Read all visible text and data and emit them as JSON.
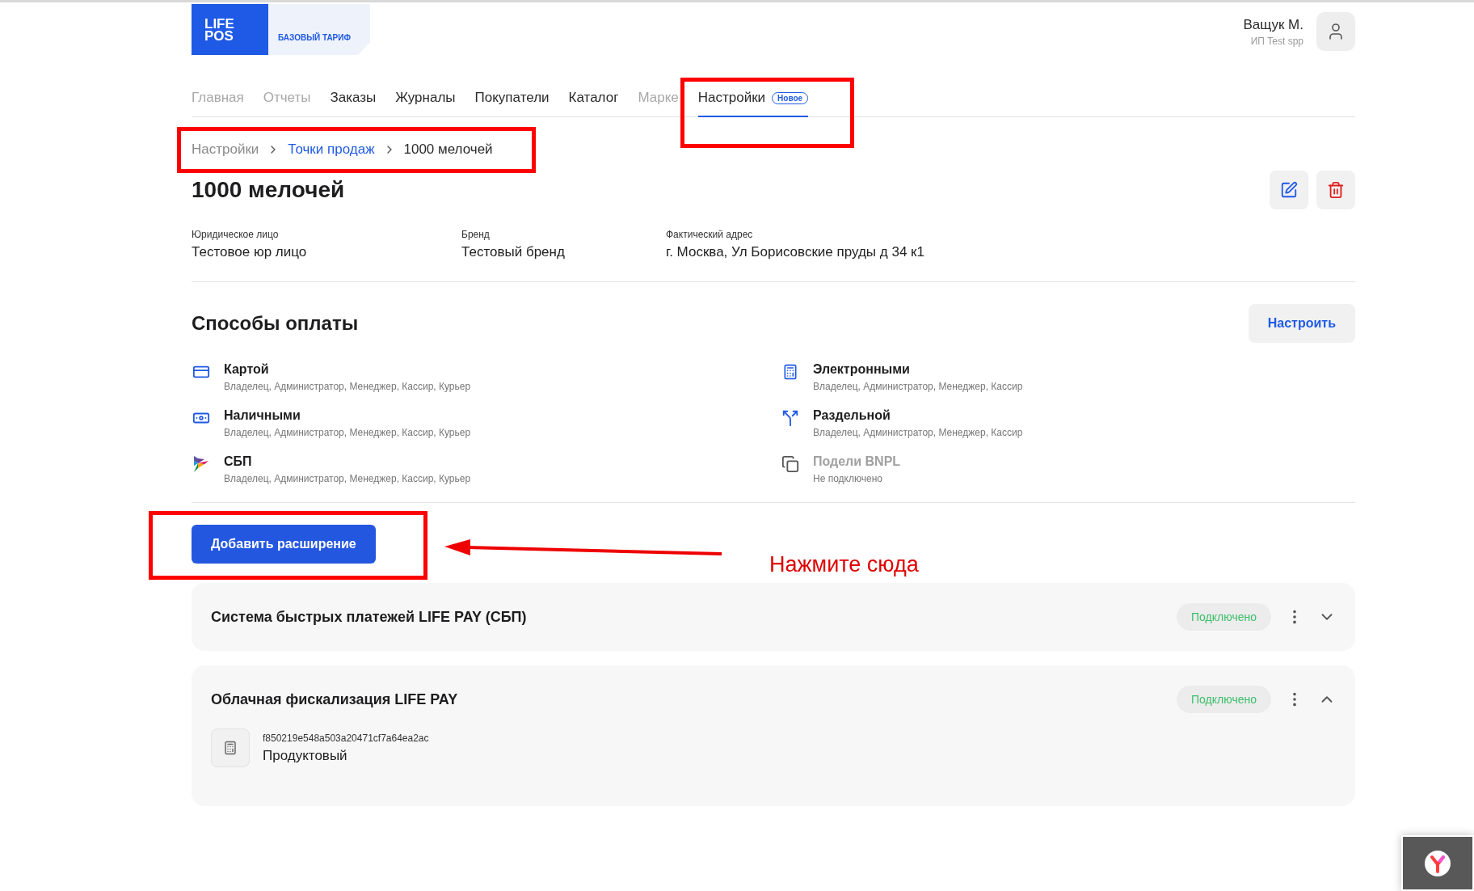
{
  "header": {
    "logo": [
      "LIFE",
      "POS"
    ],
    "plan": "БАЗОВЫЙ ТАРИФ",
    "user": {
      "name": "Ващук М.",
      "org": "ИП Test spp"
    }
  },
  "nav": [
    {
      "label": "Главная",
      "selected": false,
      "muted": true
    },
    {
      "label": "Отчеты",
      "selected": false,
      "muted": true
    },
    {
      "label": "Заказы",
      "selected": false,
      "muted": false
    },
    {
      "label": "Журналы",
      "selected": false,
      "muted": false
    },
    {
      "label": "Покупатели",
      "selected": false,
      "muted": false
    },
    {
      "label": "Каталог",
      "selected": false,
      "muted": false
    },
    {
      "label": "Марке",
      "selected": false,
      "muted": true
    },
    {
      "label": "Настройки",
      "selected": true,
      "muted": false,
      "badge": "Новое"
    }
  ],
  "breadcrumb": [
    {
      "label": "Настройки",
      "kind": "root"
    },
    {
      "label": "Точки продаж",
      "kind": "link"
    },
    {
      "label": "1000 мелочей",
      "kind": "current"
    }
  ],
  "title": "1000 мелочей",
  "info": [
    {
      "label": "Юридическое лицо",
      "value": "Тестовое юр лицо"
    },
    {
      "label": "Бренд",
      "value": "Тестовый бренд"
    },
    {
      "label": "Фактический адрес",
      "value": "г. Москва, Ул Борисовские пруды д 34 к1"
    }
  ],
  "payments": {
    "title": "Способы оплаты",
    "configure": "Настроить",
    "methods": [
      {
        "kind": "card",
        "name": "Картой",
        "roles": "Владелец, Администратор, Менеджер, Кассир, Курьер",
        "connected": true
      },
      {
        "kind": "electronic",
        "name": "Электронными",
        "roles": "Владелец, Администратор, Менеджер, Кассир",
        "connected": true
      },
      {
        "kind": "cash",
        "name": "Наличными",
        "roles": "Владелец, Администратор, Менеджер, Кассир, Курьер",
        "connected": true
      },
      {
        "kind": "split",
        "name": "Раздельной",
        "roles": "Владелец, Администратор, Менеджер, Кассир",
        "connected": true
      },
      {
        "kind": "sbp",
        "name": "СБП",
        "roles": "Владелец, Администратор, Менеджер, Кассир, Курьер",
        "connected": true
      },
      {
        "kind": "bnpl",
        "name": "Подели BNPL",
        "roles": "Не подключено",
        "connected": false
      }
    ]
  },
  "add_button": "Добавить расширение",
  "extensions": [
    {
      "title": "Система быстрых платежей LIFE PAY (СБП)",
      "status": "Подключено",
      "expanded": false
    },
    {
      "title": "Облачная фискализация LIFE PAY",
      "status": "Подключено",
      "expanded": true,
      "device": {
        "id": "f850219e548a503a20471cf7a64ea2ac",
        "name": "Продуктовый"
      }
    }
  ],
  "annotation": {
    "text": "Нажмите сюда"
  }
}
